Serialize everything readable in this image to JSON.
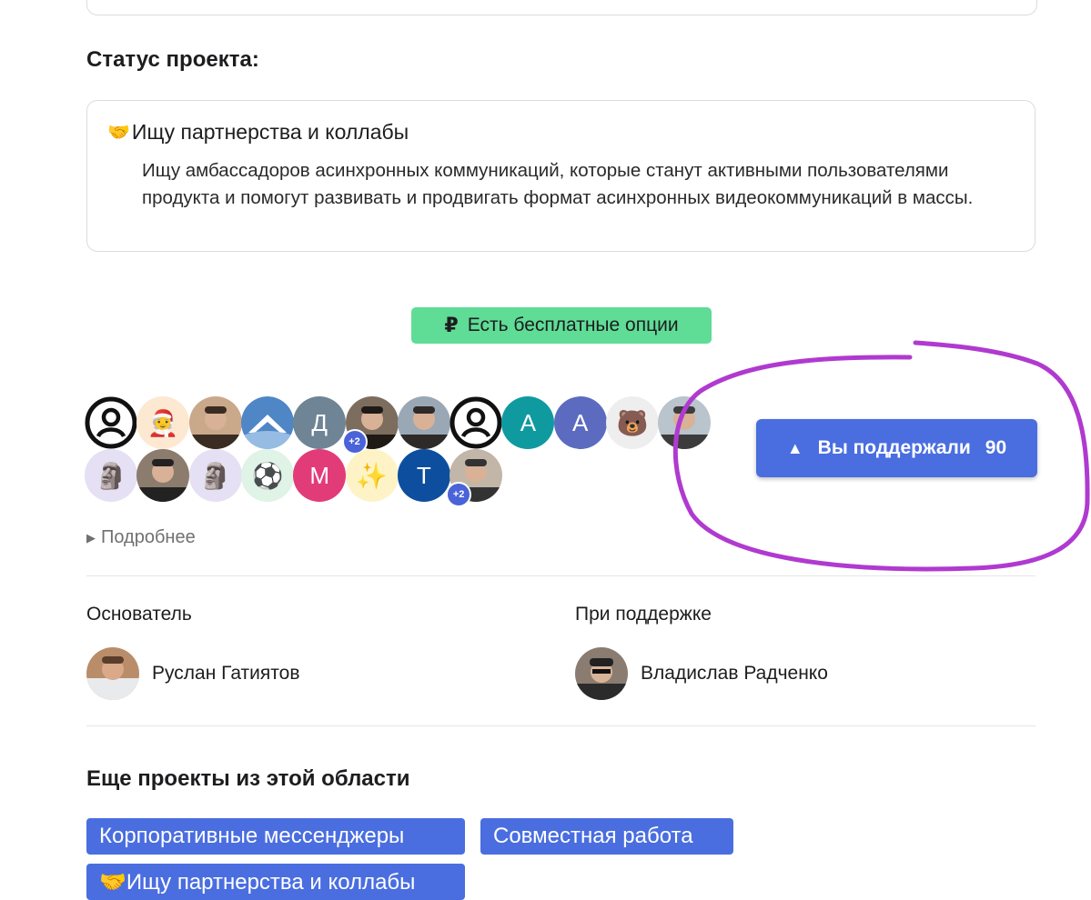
{
  "status_section": {
    "heading": "Статус проекта:",
    "title_emoji": "🤝",
    "title": "Ищу партнерства и коллабы",
    "description": "Ищу амбассадоров асинхронных коммуникаций, которые станут активными пользователями продукта и помогут развивать и продвигать формат асинхронных видеокоммуникаций в массы."
  },
  "free_badge": {
    "symbol": "₽",
    "label": "Есть бесплатные опции",
    "color": "#5fdc96"
  },
  "supporters": {
    "row1": [
      {
        "kind": "user-icon"
      },
      {
        "kind": "emoji",
        "text": "🧑‍🎄"
      },
      {
        "kind": "photo"
      },
      {
        "kind": "logo"
      },
      {
        "kind": "letter",
        "text": "Д",
        "color": "#6f8494"
      },
      {
        "kind": "photo",
        "badge": "+2"
      },
      {
        "kind": "photo"
      },
      {
        "kind": "user-icon"
      },
      {
        "kind": "letter",
        "text": "А",
        "color": "#0f9aa0"
      },
      {
        "kind": "letter",
        "text": "А",
        "color": "#5c6bc0"
      },
      {
        "kind": "emoji",
        "text": "🐻"
      },
      {
        "kind": "photo"
      }
    ],
    "row2": [
      {
        "kind": "emoji",
        "text": "🗿"
      },
      {
        "kind": "photo"
      },
      {
        "kind": "emoji",
        "text": "🗿"
      },
      {
        "kind": "emoji",
        "text": "⚽"
      },
      {
        "kind": "letter",
        "text": "М",
        "color": "#e23c78"
      },
      {
        "kind": "emoji",
        "text": "✨"
      },
      {
        "kind": "letter",
        "text": "Т",
        "color": "#0d4f9e"
      },
      {
        "kind": "photo",
        "badge": "+2"
      }
    ]
  },
  "support_button": {
    "icon": "triangle-up-icon",
    "label": "Вы поддержали",
    "count": "90",
    "color": "#4a6ee0"
  },
  "details_toggle": {
    "label": "Подробнее"
  },
  "founder": {
    "label": "Основатель",
    "name": "Руслан Гатиятов"
  },
  "backer": {
    "label": "При поддержке",
    "name": "Владислав Радченко"
  },
  "more_projects": {
    "heading": "Еще проекты из этой области",
    "tags": [
      "Корпоративные мессенджеры",
      "Совместная работа",
      "🤝Ищу партнерства и коллабы"
    ]
  },
  "annotation_color": "#b03ad0"
}
